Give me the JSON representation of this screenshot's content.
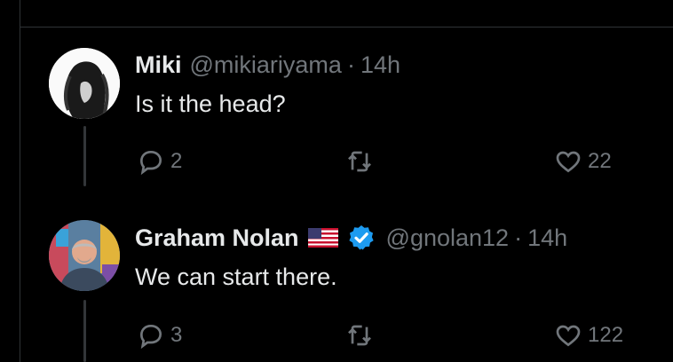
{
  "replies": [
    {
      "name": "Miki",
      "handle": "@mikiariyama",
      "separator": "·",
      "time": "14h",
      "text": "Is it the head?",
      "reply_count": "2",
      "like_count": "22"
    },
    {
      "name": "Graham Nolan",
      "handle": "@gnolan12",
      "separator": "·",
      "time": "14h",
      "text": "We can start there.",
      "reply_count": "3",
      "like_count": "122"
    }
  ],
  "colors": {
    "background": "#000000",
    "text_primary": "#e7e9ea",
    "text_secondary": "#71767b",
    "verified": "#1d9bf0",
    "divider": "#2f3336"
  }
}
